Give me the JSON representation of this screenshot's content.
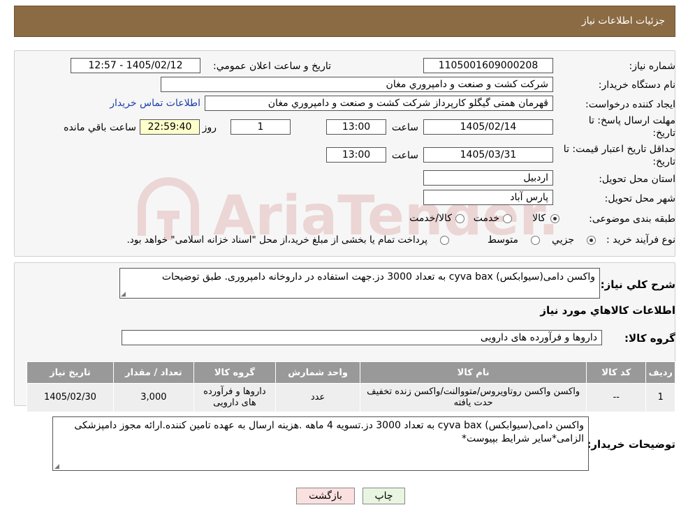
{
  "header": {
    "title": "جزئيات اطلاعات نياز"
  },
  "form": {
    "need_number_label": "شماره نياز:",
    "need_number": "1105001609000208",
    "announce_label": "تاريخ و ساعت اعلان عمومي:",
    "announce_value": "1405/02/12 - 12:57",
    "buyer_org_label": "نام دستگاه خريدار:",
    "buyer_org": "شركت كشت و صنعت و دامپروري مغان",
    "creator_label": "ايجاد كننده درخواست:",
    "creator": "قهرمان همتی گیگلو کارپرداز شركت كشت و صنعت و دامپروري مغان",
    "contact_link": "اطلاعات تماس خريدار",
    "deadline_label_1": "مهلت ارسال پاسخ: تا",
    "deadline_label_2": "تاريخ:",
    "deadline_date": "1405/02/14",
    "time_label": "ساعت",
    "deadline_time": "13:00",
    "days": "1",
    "days_label": "روز و",
    "remaining_time": "22:59:40",
    "remaining_label": "ساعت باقي مانده",
    "validity_label_1": "حداقل تاريخ اعتبار قيمت: تا",
    "validity_label_2": "تاريخ:",
    "validity_date": "1405/03/31",
    "validity_time": "13:00",
    "province_label": "استان محل تحويل:",
    "province": "اردبيل",
    "city_label": "شهر محل تحويل:",
    "city": "پارس آباد",
    "category_label": "طبقه بندی موضوعی:",
    "category_options": [
      "كالا",
      "خدمت",
      "كالا/خدمت"
    ],
    "category_selected": "كالا",
    "process_label": "نوع فرآيند خريد :",
    "process_options": [
      "جزيي",
      "متوسط"
    ],
    "process_selected": "جزيي",
    "process_note": "پرداخت تمام يا بخشی از مبلغ خريد،از محل \"اسناد خزانه اسلامی\" خواهد بود."
  },
  "summary": {
    "label": "شرح كلي نياز:",
    "text": "واکسن دامی(سیوابکس) cyva bax به تعداد 3000 دز.جهت استفاده در داروخانه دامپروری. طبق توضیحات"
  },
  "goods": {
    "section_title": "اطلاعات كالاهاي مورد نياز",
    "group_label": "گروه كالا:",
    "group_value": "داروها و فرآورده های دارويی",
    "columns": [
      "رديف",
      "كد كالا",
      "نام كالا",
      "واحد شمارش",
      "گروه كالا",
      "تعداد / مقدار",
      "تاريخ نياز"
    ],
    "rows": [
      [
        "1",
        "--",
        "واکسن واکسن روتاویروس/متووالنت/واکسن زنده تخفیف حدت یافته",
        "عدد",
        "داروها و فرآورده های دارويی",
        "3,000",
        "1405/02/30"
      ]
    ]
  },
  "buyer_notes": {
    "label": "توضيحات خريدار:",
    "text": "واکسن دامی(سیوابکس) cyva bax به تعداد 3000 دز.تسویه 4 ماهه .هزینه ارسال به عهده تامین کننده.ارائه مجوز دامپزشکی الزامی*سایر شرایط بپیوست*"
  },
  "buttons": {
    "print": "چاپ",
    "back": "بازگشت"
  },
  "watermark": {
    "text": "AriaTender.neT"
  },
  "colors": {
    "header_bg": "#8b6b43",
    "table_header": "#999999",
    "print_btn": "#e8f5e0",
    "back_btn": "#fbe0e0",
    "link": "#1a3fa8"
  }
}
